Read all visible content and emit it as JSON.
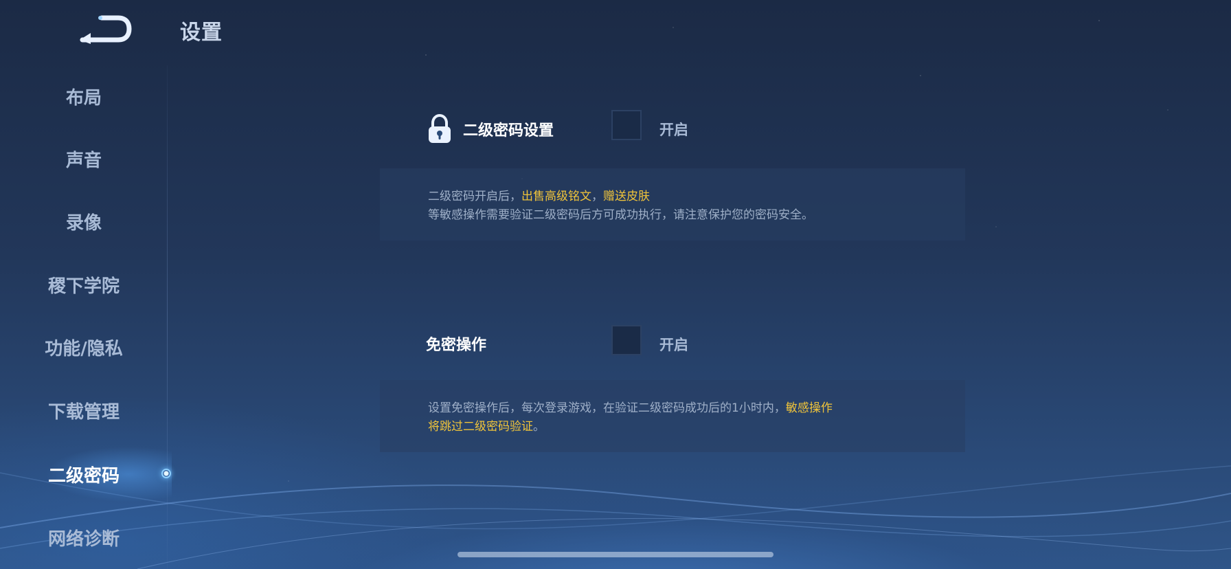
{
  "header": {
    "title": "设置",
    "back_icon": "back-arrow-icon"
  },
  "sidebar": {
    "items": [
      {
        "label": "布局",
        "active": false
      },
      {
        "label": "声音",
        "active": false
      },
      {
        "label": "录像",
        "active": false
      },
      {
        "label": "稷下学院",
        "active": false
      },
      {
        "label": "功能/隐私",
        "active": false
      },
      {
        "label": "下载管理",
        "active": false
      },
      {
        "label": "二级密码",
        "active": true
      },
      {
        "label": "网络诊断",
        "active": false
      }
    ]
  },
  "secondary_password": {
    "icon": "lock-icon",
    "label": "二级密码设置",
    "toggle_label": "开启",
    "checked": false,
    "desc_line1_prefix": "二级密码开启后，",
    "desc_line1_hl1": "出售高级铭文",
    "desc_line1_sep": "，",
    "desc_line1_hl2": "赠送皮肤",
    "desc_line2": "等敏感操作需要验证二级密码后方可成功执行，请注意保护您的密码安全。"
  },
  "password_free": {
    "label": "免密操作",
    "toggle_label": "开启",
    "checked": false,
    "desc_line1_prefix": "设置免密操作后，每次登录游戏，在验证二级密码成功后的1小时内，",
    "desc_line1_hl": "敏感操作",
    "desc_line2_hl": "将跳过二级密码验证",
    "desc_line2_suffix": "。"
  },
  "colors": {
    "highlight": "#f0c43a",
    "active_text": "#ffffff",
    "inactive_text": "#a9bbd6"
  }
}
